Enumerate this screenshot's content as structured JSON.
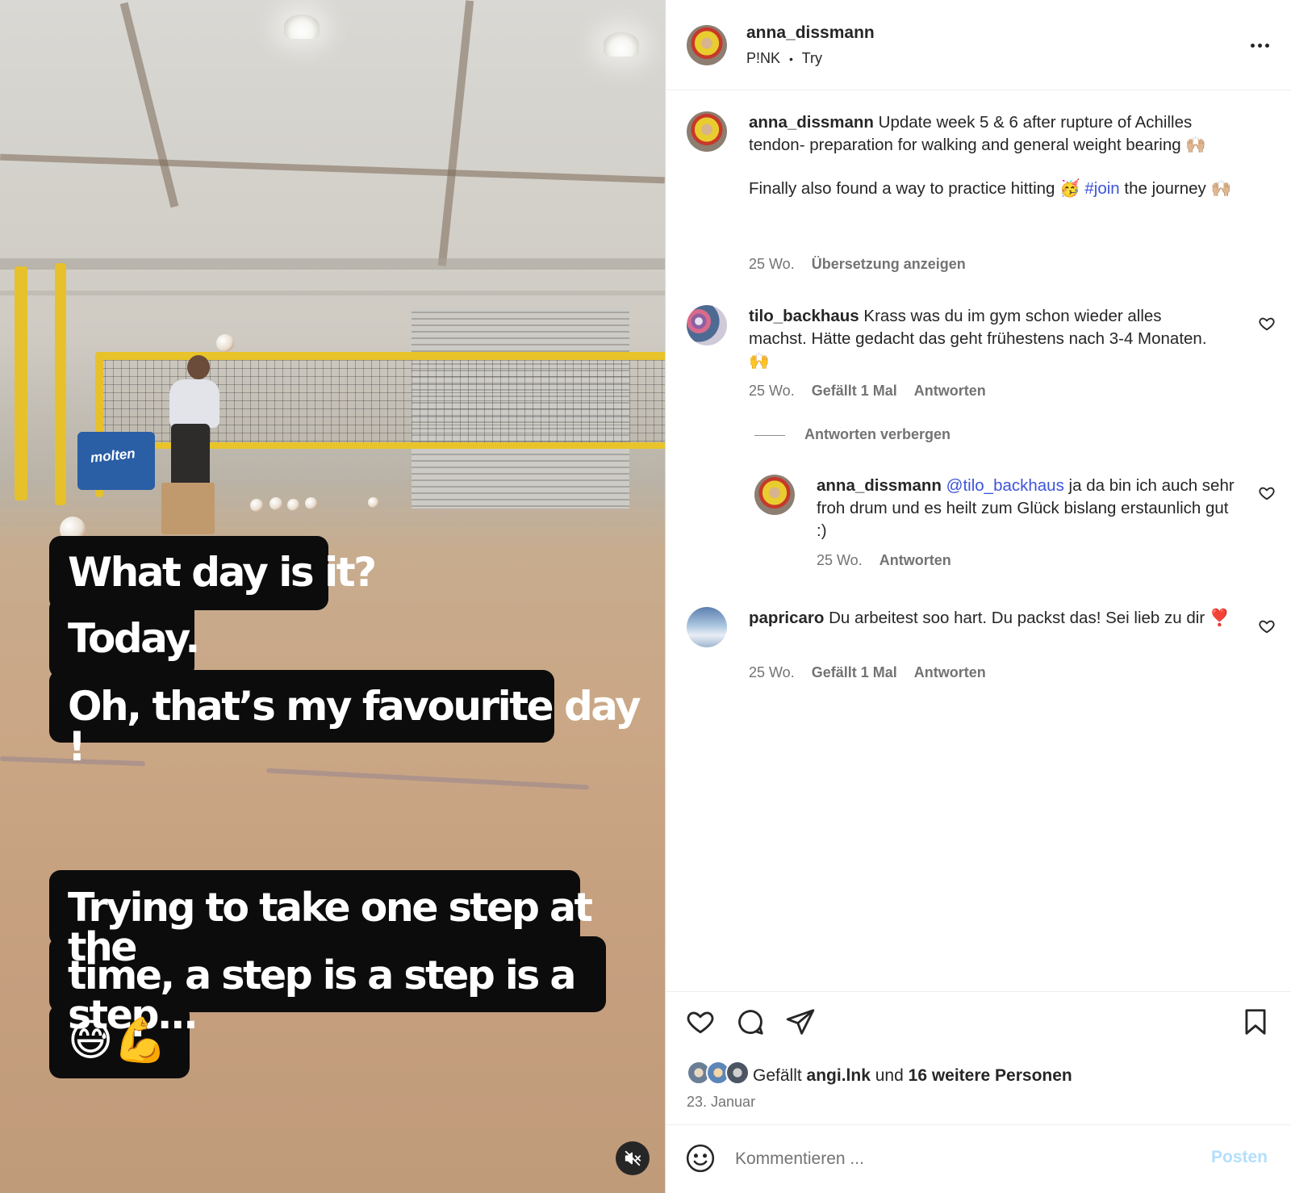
{
  "post": {
    "username": "anna_dissmann",
    "audio_artist": "P!NK",
    "audio_separator": "•",
    "audio_track": "Try",
    "more_icon": "more-horizontal-icon"
  },
  "video": {
    "overlay_lines_1": [
      "What day is it?",
      "Today.",
      "Oh, that’s my favourite day !"
    ],
    "overlay_lines_2": [
      "Trying to take one step at the",
      "time, a step is a step is a step...",
      "😅💪"
    ],
    "chair_brand": "molten",
    "mute_icon": "speaker-muted-icon"
  },
  "caption": {
    "username": "anna_dissmann",
    "text_1": "Update week 5 & 6 after rupture of Achilles tendon- preparation for walking and general weight bearing 🙌🏼",
    "text_2_before": "Finally also found a way to practice hitting 🥳 ",
    "hashtag": "#join",
    "text_2_after": " the journey 🙌🏼",
    "time": "25 Wo.",
    "translate": "Übersetzung anzeigen"
  },
  "comments": [
    {
      "username": "tilo_backhaus",
      "text": "Krass was du im gym schon wieder alles machst. Hätte gedacht das geht frühestens nach 3-4 Monaten. 🙌",
      "time": "25 Wo.",
      "likes": "Gefällt 1 Mal",
      "reply": "Antworten",
      "hide_replies": "Antworten verbergen"
    },
    {
      "username": "anna_dissmann",
      "mention": "@tilo_backhaus",
      "text": " ja da bin ich auch sehr froh drum und es heilt zum Glück bislang erstaunlich gut :)",
      "time": "25 Wo.",
      "reply": "Antworten"
    },
    {
      "username": "papricaro",
      "text": "Du arbeitest soo hart. Du packst das! Sei lieb zu dir ❣️",
      "time": "25 Wo.",
      "likes": "Gefällt 1 Mal",
      "reply": "Antworten"
    }
  ],
  "actions": {
    "like_icon": "heart-icon",
    "comment_icon": "comment-icon",
    "share_icon": "paper-plane-icon",
    "save_icon": "bookmark-icon",
    "likes_prefix": "Gefällt",
    "likes_user": "angi.lnk",
    "likes_and": "und",
    "likes_others": "16 weitere Personen",
    "date": "23. Januar"
  },
  "composer": {
    "emoji_icon": "smiley-icon",
    "placeholder": "Kommentieren ...",
    "post_label": "Posten"
  },
  "colors": {
    "link": "#3d54d8",
    "post_disabled": "#b2dffc",
    "muted_text": "#737373"
  }
}
